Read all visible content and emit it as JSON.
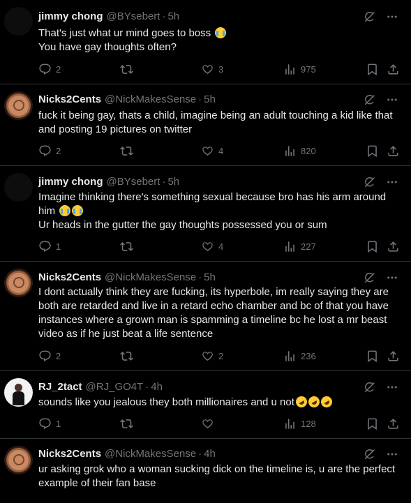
{
  "tweets": [
    {
      "name": "jimmy chong",
      "handle": "@BYsebert",
      "time": "5h",
      "lines": [
        "That's just what ur mind goes to boss",
        "You have gay thoughts often?"
      ],
      "replies": "2",
      "reposts": "",
      "likes": "3",
      "views": "975"
    },
    {
      "name": "Nicks2Cents",
      "handle": "@NickMakesSense",
      "time": "5h",
      "lines": [
        "fuck it being gay, thats a child, imagine being an adult touching  a kid like that",
        "and posting 19 pictures on twitter"
      ],
      "replies": "2",
      "reposts": "",
      "likes": "4",
      "views": "820"
    },
    {
      "name": "jimmy chong",
      "handle": "@BYsebert",
      "time": "5h",
      "lines": [
        "Imagine thinking there's something sexual because bro has his arm around",
        "him",
        "Ur heads in the gutter the gay thoughts possessed you or sum"
      ],
      "replies": "1",
      "reposts": "",
      "likes": "4",
      "views": "227"
    },
    {
      "name": "Nicks2Cents",
      "handle": "@NickMakesSense",
      "time": "5h",
      "lines": [
        "I dont actually think they are fucking, its hyperbole, im really saying they are",
        "both are retarded and live in a retard echo chamber and bc of that you have",
        "instances where a grown man is spamming a timeline bc he lost a mr beast",
        "video as if he just beat a life sentence"
      ],
      "replies": "2",
      "reposts": "",
      "likes": "2",
      "views": "236"
    },
    {
      "name": "RJ_2tact",
      "handle": "@RJ_GO4T",
      "time": "4h",
      "lines": [
        "sounds like you jealous they both millionaires and u not"
      ],
      "replies": "1",
      "reposts": "",
      "likes": "",
      "views": "128"
    },
    {
      "name": "Nicks2Cents",
      "handle": "@NickMakesSense",
      "time": "4h",
      "lines": [
        "ur asking grok who a woman sucking dick on the timeline is, u are the perfect",
        "example of their fan base"
      ],
      "replies": "",
      "reposts": "",
      "likes": "",
      "views": ""
    }
  ],
  "separator": "·",
  "icons": [
    "reply-icon",
    "repost-icon",
    "like-icon",
    "views-icon",
    "bookmark-icon",
    "share-icon",
    "grok-icon",
    "more-icon"
  ]
}
